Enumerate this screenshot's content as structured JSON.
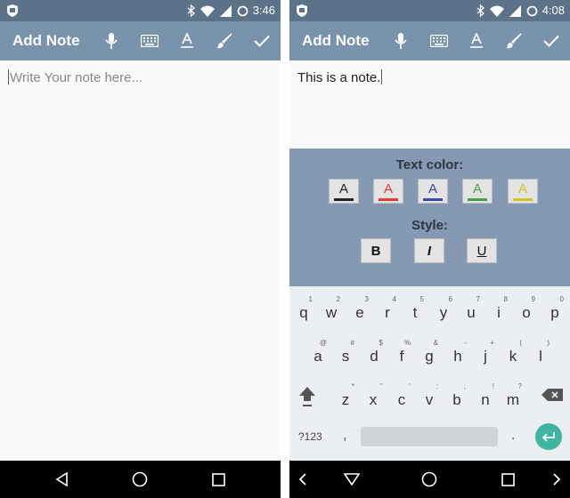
{
  "left": {
    "status_time": "3:46",
    "appbar_title": "Add Note",
    "note_placeholder": "Write Your note here..."
  },
  "right": {
    "status_time": "4:08",
    "appbar_title": "Add Note",
    "note_text": "This is a note.",
    "format_panel": {
      "text_color_label": "Text color:",
      "style_label": "Style:",
      "swatch_glyph": "A",
      "text_colors": [
        "#222222",
        "#e53935",
        "#3949ab",
        "#43a047",
        "#d4c12a"
      ],
      "bold_label": "B",
      "italic_label": "I",
      "underline_label": "U"
    },
    "keyboard": {
      "row1": [
        {
          "k": "q",
          "h": "1"
        },
        {
          "k": "w",
          "h": "2"
        },
        {
          "k": "e",
          "h": "3"
        },
        {
          "k": "r",
          "h": "4"
        },
        {
          "k": "t",
          "h": "5"
        },
        {
          "k": "y",
          "h": "6"
        },
        {
          "k": "u",
          "h": "7"
        },
        {
          "k": "i",
          "h": "8"
        },
        {
          "k": "o",
          "h": "9"
        },
        {
          "k": "p",
          "h": "0"
        }
      ],
      "row2": [
        {
          "k": "a",
          "h": "@"
        },
        {
          "k": "s",
          "h": "#"
        },
        {
          "k": "d",
          "h": "$"
        },
        {
          "k": "f",
          "h": "%"
        },
        {
          "k": "g",
          "h": "&"
        },
        {
          "k": "h",
          "h": "-"
        },
        {
          "k": "j",
          "h": "+"
        },
        {
          "k": "k",
          "h": "("
        },
        {
          "k": "l",
          "h": ")"
        }
      ],
      "row3": [
        {
          "k": "z",
          "h": "*"
        },
        {
          "k": "x",
          "h": "\""
        },
        {
          "k": "c",
          "h": "'"
        },
        {
          "k": "v",
          "h": ":"
        },
        {
          "k": "b",
          "h": ";"
        },
        {
          "k": "n",
          "h": "!"
        },
        {
          "k": "m",
          "h": "?"
        }
      ],
      "symbols_label": "?123",
      "comma": ",",
      "period": "."
    }
  },
  "icons": {
    "appbar_actions": [
      "microphone-icon",
      "keyboard-icon",
      "text-format-icon",
      "brush-icon",
      "check-icon"
    ],
    "status": [
      "shield-icon",
      "bluetooth-icon",
      "wifi-icon",
      "signal-icon",
      "sync-icon"
    ],
    "nav_left": [
      "back-icon",
      "home-icon",
      "recents-icon"
    ],
    "nav_right": [
      "chevron-left-icon",
      "back-icon",
      "home-icon",
      "recents-icon",
      "chevron-right-icon"
    ]
  },
  "colors": {
    "statusbar": "#5b7288",
    "appbar": "#7a93ad",
    "panel": "#8599b2",
    "enter_key": "#3fb5a1"
  }
}
